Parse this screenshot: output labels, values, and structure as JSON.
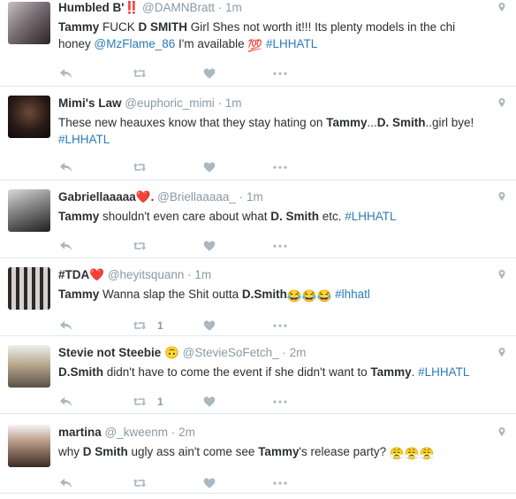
{
  "tweets": [
    {
      "name": "Humbled B'",
      "handle": "@DAMNBratt",
      "sep": "·",
      "time": "1m",
      "text_parts": [
        {
          "t": "Tammy",
          "c": "hl"
        },
        {
          "t": " FUCK ",
          "c": ""
        },
        {
          "t": "D SMITH",
          "c": "hl"
        },
        {
          "t": " Girl Shes not worth it!!! Its plenty models in the chi honey ",
          "c": ""
        },
        {
          "t": "@MzFlame_86",
          "c": "mention"
        },
        {
          "t": " I'm available ",
          "c": ""
        },
        {
          "t": "💯",
          "c": "emoji"
        },
        {
          "t": " ",
          "c": ""
        },
        {
          "t": "#LHHATL",
          "c": "tag"
        }
      ],
      "retweets": "",
      "name_emoji": "‼️"
    },
    {
      "name": "Mimi's Law",
      "handle": "@euphoric_mimi",
      "sep": "·",
      "time": "1m",
      "text_parts": [
        {
          "t": "These new heauxes know that they stay hating on ",
          "c": ""
        },
        {
          "t": "Tammy",
          "c": "hl"
        },
        {
          "t": "...",
          "c": ""
        },
        {
          "t": "D. Smith",
          "c": "hl"
        },
        {
          "t": "..girl bye! ",
          "c": ""
        },
        {
          "t": "#LHHATL",
          "c": "tag"
        }
      ],
      "retweets": "",
      "name_emoji": ""
    },
    {
      "name": "Gabriellaaaaa",
      "handle": "@Briellaaaaa_",
      "sep": "·",
      "time": "1m",
      "text_parts": [
        {
          "t": "Tammy",
          "c": "hl"
        },
        {
          "t": " shouldn't even care about what ",
          "c": ""
        },
        {
          "t": "D. Smith",
          "c": "hl"
        },
        {
          "t": " etc.  ",
          "c": ""
        },
        {
          "t": "#LHHATL",
          "c": "tag"
        }
      ],
      "retweets": "",
      "name_emoji": "❤️."
    },
    {
      "name": "#TDA",
      "handle": "@heyitsquann",
      "sep": "·",
      "time": "1m",
      "text_parts": [
        {
          "t": "Tammy",
          "c": "hl"
        },
        {
          "t": " Wanna slap the Shit outta ",
          "c": ""
        },
        {
          "t": "D.Smith",
          "c": "hl"
        },
        {
          "t": "😂😂😂",
          "c": "emoji"
        },
        {
          "t": " ",
          "c": ""
        },
        {
          "t": "#lhhatl",
          "c": "tag"
        }
      ],
      "retweets": "1",
      "name_emoji": "❤️"
    },
    {
      "name": "Stevie not Steebie 🙃",
      "handle": "@StevieSoFetch_",
      "sep": "·",
      "time": "2m",
      "text_parts": [
        {
          "t": "D.Smith",
          "c": "hl"
        },
        {
          "t": " didn't have to come the event if she didn't want to ",
          "c": ""
        },
        {
          "t": "Tammy",
          "c": "hl"
        },
        {
          "t": ". ",
          "c": ""
        },
        {
          "t": "#LHHATL",
          "c": "tag"
        }
      ],
      "retweets": "1",
      "name_emoji": ""
    },
    {
      "name": "martina",
      "handle": "@_kweenm",
      "sep": "·",
      "time": "2m",
      "text_parts": [
        {
          "t": "why ",
          "c": ""
        },
        {
          "t": "D Smith",
          "c": "hl"
        },
        {
          "t": " ugly ass ain't come see ",
          "c": ""
        },
        {
          "t": "Tammy",
          "c": "hl"
        },
        {
          "t": "'s release party? ",
          "c": ""
        },
        {
          "t": "😤😤😤",
          "c": "emoji"
        }
      ],
      "retweets": "",
      "name_emoji": ""
    }
  ],
  "icons": {
    "reply": "reply-icon",
    "retweet": "retweet-icon",
    "like": "heart-icon",
    "more": "more-icon",
    "location": "location-pin-icon"
  },
  "colors": {
    "link": "#2b7bb9",
    "meta": "#8899a6",
    "icon": "#aab8c2",
    "text": "#292f33",
    "divider": "#e1e8ed"
  }
}
